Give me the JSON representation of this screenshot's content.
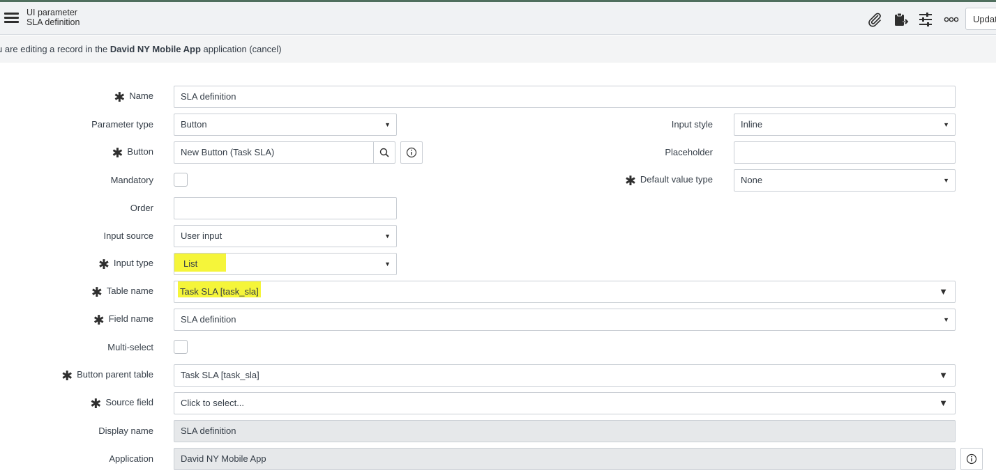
{
  "header": {
    "title": "UI parameter",
    "subtitle": "SLA definition",
    "update_label": "Updat"
  },
  "banner": {
    "prefix": "u are editing a record in the",
    "app": "David NY Mobile App",
    "suffix": "application",
    "cancel": "(cancel)"
  },
  "icons": {
    "menu": "hamburger-menu-icon",
    "attachment": "paperclip-icon",
    "clipboard": "clipboard-icon",
    "settings": "sliders-icon",
    "more": "more-options-icon",
    "search": "search-icon",
    "info": "info-icon",
    "required": "asterisk-icon"
  },
  "colors": {
    "highlight": "#f5f53a",
    "header_bg": "#f0f2f4",
    "readonly_bg": "#e6e8ea",
    "top_stripe": "#4f6f5e"
  },
  "form": {
    "name": {
      "label": "Name",
      "value": "SLA definition",
      "required": true
    },
    "parameter_type": {
      "label": "Parameter type",
      "value": "Button"
    },
    "button": {
      "label": "Button",
      "value": "New Button (Task SLA)",
      "required": true
    },
    "mandatory": {
      "label": "Mandatory",
      "checked": false
    },
    "order": {
      "label": "Order",
      "value": ""
    },
    "input_source": {
      "label": "Input source",
      "value": "User input"
    },
    "input_type": {
      "label": "Input type",
      "value": "List",
      "required": true
    },
    "table_name": {
      "label": "Table name",
      "value": "Task SLA [task_sla]",
      "required": true
    },
    "field_name": {
      "label": "Field name",
      "value": "SLA definition",
      "required": true
    },
    "multi_select": {
      "label": "Multi-select",
      "checked": false
    },
    "button_parent_table": {
      "label": "Button parent table",
      "value": "Task SLA [task_sla]",
      "required": true
    },
    "source_field": {
      "label": "Source field",
      "value": "Click to select...",
      "required": true
    },
    "display_name": {
      "label": "Display name",
      "value": "SLA definition"
    },
    "application": {
      "label": "Application",
      "value": "David NY Mobile App"
    },
    "input_style": {
      "label": "Input style",
      "value": "Inline"
    },
    "placeholder": {
      "label": "Placeholder",
      "value": ""
    },
    "default_value_type": {
      "label": "Default value type",
      "value": "None",
      "required": true
    }
  }
}
